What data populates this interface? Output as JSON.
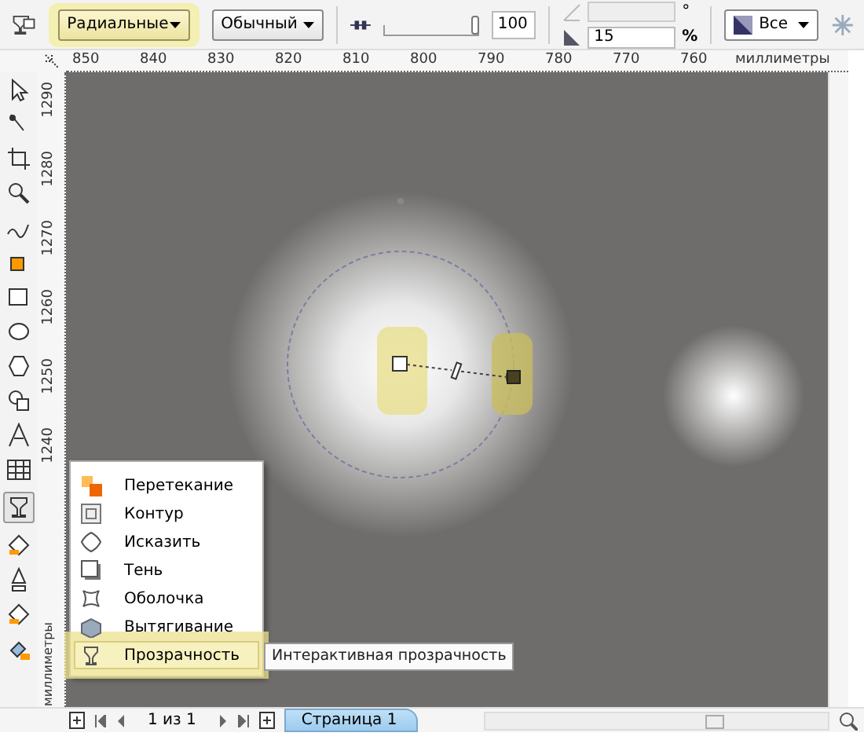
{
  "property_bar": {
    "fill_type": {
      "value": "Радиальные",
      "highlighted": true
    },
    "merge_mode": {
      "value": "Обычный"
    },
    "transparency": {
      "level": 1,
      "value": "100"
    },
    "angle": {
      "disabled": true
    },
    "edge_pad": {
      "value": "15",
      "unit": "%",
      "degree_unit": "°"
    },
    "target": {
      "value": "Все"
    }
  },
  "horizontal_ruler": {
    "labels": [
      "850",
      "840",
      "830",
      "820",
      "810",
      "800",
      "790",
      "780",
      "770",
      "760"
    ],
    "unit": "миллиметры"
  },
  "vertical_ruler": {
    "labels": [
      "1290",
      "1280",
      "1270",
      "1260",
      "1250",
      "1240"
    ],
    "unit": "миллиметры"
  },
  "canvas": {
    "gradient_midpoint": {
      "level": 0.5
    }
  },
  "flyout_menu": {
    "items": [
      {
        "label": "Перетекание",
        "selected": false
      },
      {
        "label": "Контур",
        "selected": false
      },
      {
        "label": "Исказить",
        "selected": false
      },
      {
        "label": "Тень",
        "selected": false
      },
      {
        "label": "Оболочка",
        "selected": false
      },
      {
        "label": "Вытягивание",
        "selected": false
      },
      {
        "label": "Прозрачность",
        "selected": true
      }
    ]
  },
  "tooltip": "Интерактивная прозрачность",
  "page_navigator": {
    "page_count": "1 из 1",
    "tabs": [
      {
        "label": "Страница 1",
        "selected": true
      }
    ]
  }
}
